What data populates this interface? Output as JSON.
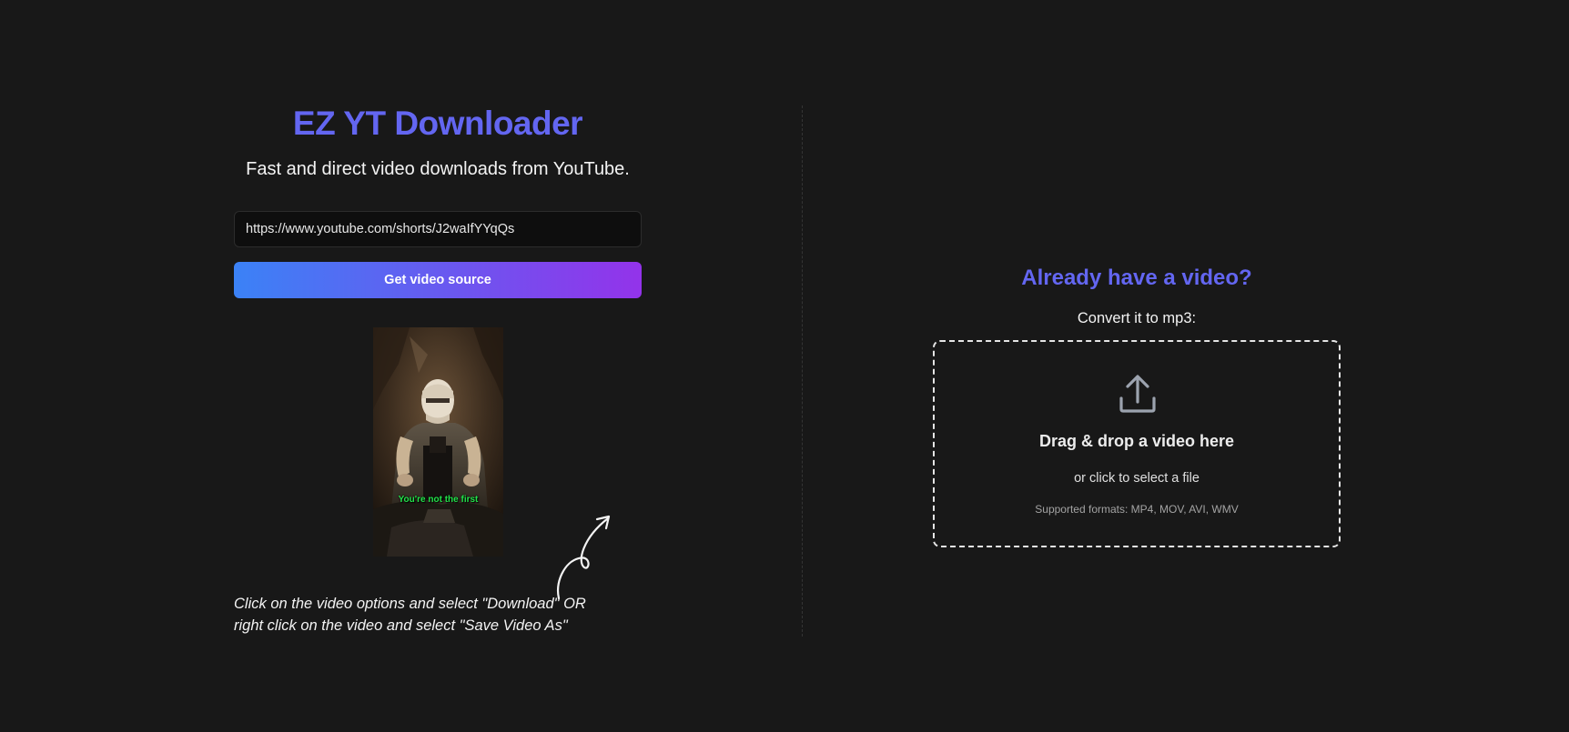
{
  "app": {
    "title": "EZ YT Downloader",
    "subtitle": "Fast and direct video downloads from YouTube."
  },
  "download": {
    "url_value": "https://www.youtube.com/shorts/J2waIfYYqQs",
    "button_label": "Get video source"
  },
  "video": {
    "caption": "You're not the first"
  },
  "hint": {
    "line1": "Click on the video options and select \"Download\" OR",
    "line2": "right click on the video and select \"Save Video As\""
  },
  "convert": {
    "title": "Already have a video?",
    "label": "Convert it to mp3:",
    "drop_title": "Drag & drop a video here",
    "drop_sub": "or click to select a file",
    "formats": "Supported formats: MP4, MOV, AVI, WMV"
  },
  "colors": {
    "background": "#181818",
    "accent": "#6366f1",
    "gradient_start": "#3b82f6",
    "gradient_end": "#9333ea",
    "caption_green": "#22e34a"
  },
  "icons": {
    "upload": "upload-icon",
    "arrow": "curly-arrow-icon"
  }
}
